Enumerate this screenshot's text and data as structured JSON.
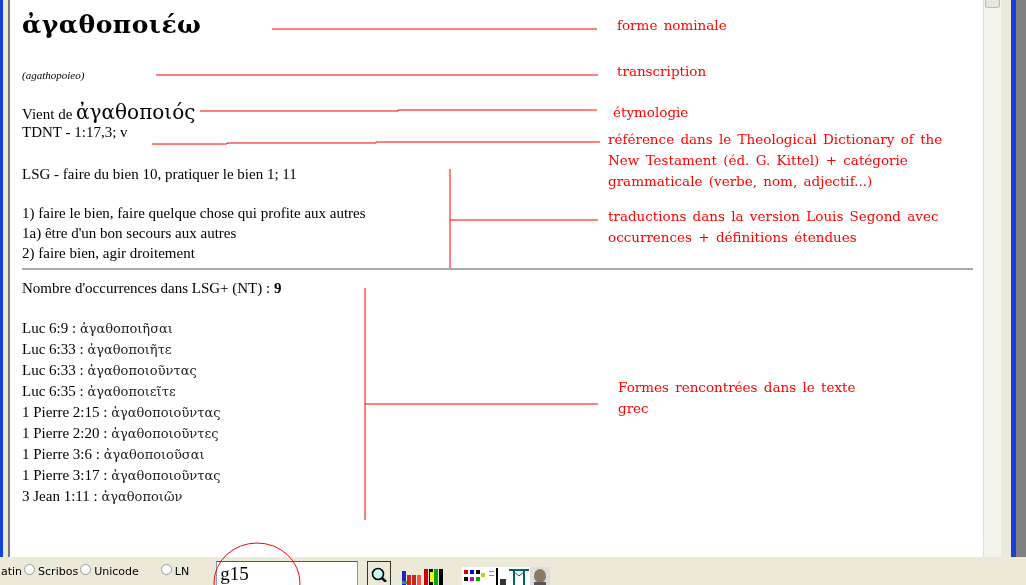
{
  "entry": {
    "headword": "ἀγαθοποιέω",
    "transcription": "(agathopoieo)",
    "etymology": {
      "prefix": "Vient de",
      "word": "ἀγαθοποιός"
    },
    "tdnt": "TDNT - 1:17,3; v",
    "lsg": "LSG - faire du bien 10, pratiquer le bien 1; 11",
    "definitions": [
      "1) faire le bien, faire quelque chose qui profite aux autres",
      "1a) être d'un bon secours aux autres",
      "2) faire bien, agir droitement"
    ],
    "occurrence_count": "Nombre d'occurrences dans LSG+ (NT) : **9**",
    "occurrences": [
      {
        "ref": "Luc 6:9 :",
        "form": "ἀγαθοποιῆσαι"
      },
      {
        "ref": "Luc 6:33 :",
        "form": "ἀγαθοποιῆτε"
      },
      {
        "ref": "Luc 6:33 :",
        "form": "ἀγαθοποιοῦντας"
      },
      {
        "ref": "Luc 6:35 :",
        "form": "ἀγαθοποιεῖτε"
      },
      {
        "ref": "1 Pierre 2:15 :",
        "form": "ἀγαθοποιοῦντας"
      },
      {
        "ref": "1 Pierre 2:20 :",
        "form": "ἀγαθοποιοῦντες"
      },
      {
        "ref": "1 Pierre 3:6 :",
        "form": "ἀγαθοποιοῦσαι"
      },
      {
        "ref": "1 Pierre 3:17 :",
        "form": "ἀγαθοποιοῦντας"
      },
      {
        "ref": "3 Jean 1:11 :",
        "form": "ἀγαθοποιῶν"
      }
    ]
  },
  "annotations": [
    "forme nominale",
    "transcription",
    "étymologie",
    "référence dans le Theological Dictionary of the New Testament (éd. G. Kittel) + catégorie grammaticale (verbe, nom, adjectif...)",
    "traductions dans la version Louis Segond avec occurrences + définitions étendues",
    "Formes rencontrées dans le texte grec"
  ],
  "toolbar": {
    "fonts": [
      {
        "label": "atin"
      },
      {
        "label": "Scribos",
        "selected": false
      },
      {
        "label": "Unicode",
        "selected": false
      },
      {
        "label": "LN",
        "selected": false
      }
    ],
    "search_field": {
      "value": "g15"
    }
  }
}
